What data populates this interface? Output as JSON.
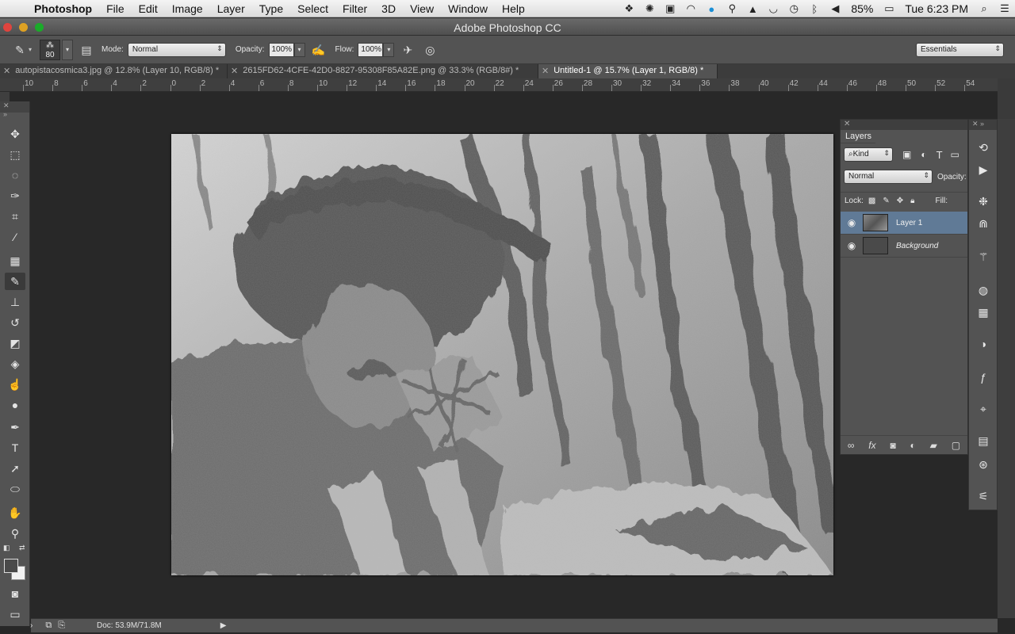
{
  "menubar": {
    "items": [
      "Photoshop",
      "File",
      "Edit",
      "Image",
      "Layer",
      "Type",
      "Select",
      "Filter",
      "3D",
      "View",
      "Window",
      "Help"
    ],
    "battery": "85%",
    "clock": "Tue 6:23 PM"
  },
  "window": {
    "title": "Adobe Photoshop CC"
  },
  "options": {
    "brush_size": "80",
    "mode_label": "Mode:",
    "mode_value": "Normal",
    "opacity_label": "Opacity:",
    "opacity_value": "100%",
    "flow_label": "Flow:",
    "flow_value": "100%",
    "workspace": "Essentials"
  },
  "tabs": [
    {
      "label": "autopistacosmica3.jpg @ 12.8% (Layer 10, RGB/8) *",
      "active": false
    },
    {
      "label": "2615FD62-4CFE-42D0-8827-95308F85A82E.png @ 33.3% (RGB/8#) *",
      "active": false
    },
    {
      "label": "Untitled-1 @ 15.7% (Layer 1, RGB/8) *",
      "active": true
    }
  ],
  "ruler": [
    "10",
    "8",
    "6",
    "4",
    "2",
    "0",
    "2",
    "4",
    "6",
    "8",
    "10",
    "12",
    "14",
    "16",
    "18",
    "20",
    "22",
    "24",
    "26",
    "28",
    "30",
    "32",
    "34",
    "36",
    "38",
    "40",
    "42",
    "44",
    "46",
    "48",
    "50",
    "52",
    "54"
  ],
  "layers_panel": {
    "tab": "Layers",
    "filter": "Kind",
    "blend_mode": "Normal",
    "opacity_label": "Opacity:",
    "lock_label": "Lock:",
    "fill_label": "Fill:",
    "layers": [
      {
        "name": "Layer 1",
        "selected": true
      },
      {
        "name": "Background",
        "selected": false
      }
    ]
  },
  "status": {
    "doc": "Doc: 53.9M/71.8M"
  },
  "colors": {
    "selected_layer": "#607a96",
    "panel": "#535353",
    "canvas_bg": "#282828"
  }
}
